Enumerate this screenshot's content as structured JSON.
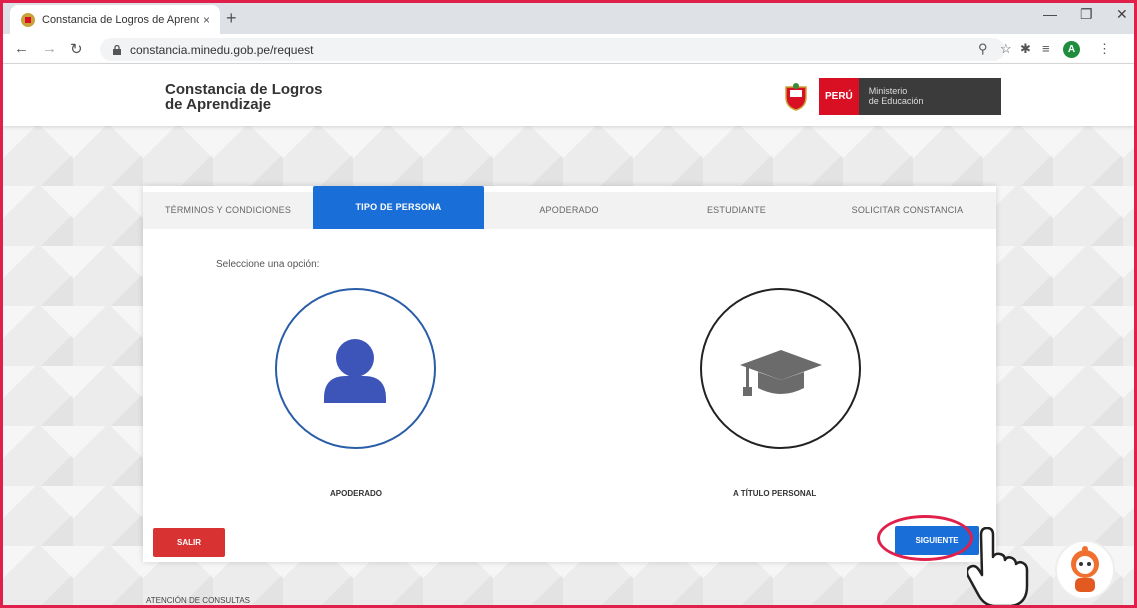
{
  "browser": {
    "tab_title": "Constancia de Logros de Aprend",
    "tab_close": "×",
    "new_tab": "+",
    "url": "constancia.minedu.gob.pe/request",
    "avatar_letter": "A"
  },
  "site": {
    "title_line1": "Constancia de Logros",
    "title_line2": "de Aprendizaje",
    "logo_peru": "PERÚ",
    "logo_ministerio_line1": "Ministerio",
    "logo_ministerio_line2": "de Educación"
  },
  "steps": [
    {
      "label": "TÉRMINOS Y CONDICIONES"
    },
    {
      "label": "TIPO DE PERSONA"
    },
    {
      "label": "APODERADO"
    },
    {
      "label": "ESTUDIANTE"
    },
    {
      "label": "SOLICITAR CONSTANCIA"
    }
  ],
  "form": {
    "prompt": "Seleccione una opción:",
    "option1_label": "APODERADO",
    "option2_label": "A TÍTULO PERSONAL"
  },
  "buttons": {
    "exit_label": "SALIR",
    "next_label": "SIGUIENTE"
  },
  "footer": {
    "text": "ATENCIÓN DE CONSULTAS"
  },
  "colors": {
    "accent": "#1a6ed8",
    "danger": "#d83232",
    "highlight": "#e0204a",
    "brand_red": "#d91023"
  }
}
